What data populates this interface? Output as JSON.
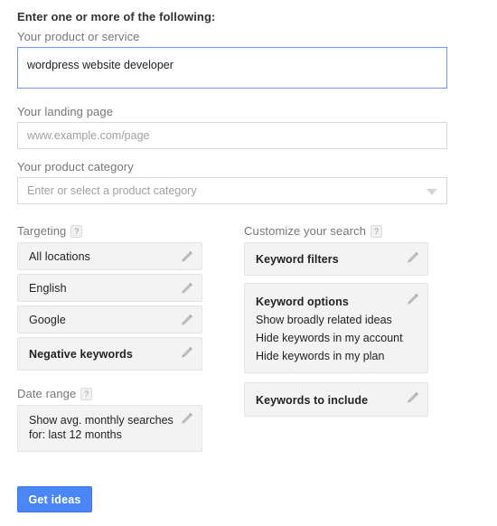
{
  "form": {
    "title": "Enter one or more of the following:",
    "product_service": {
      "label": "Your product or service",
      "value": "wordpress website developer"
    },
    "landing_page": {
      "label": "Your landing page",
      "placeholder": "www.example.com/page",
      "value": ""
    },
    "product_category": {
      "label": "Your product category",
      "placeholder": "Enter or select a product category",
      "selected": ""
    }
  },
  "targeting": {
    "heading": "Targeting",
    "help": "?",
    "items": [
      {
        "title": "All locations",
        "bold": false
      },
      {
        "title": "English",
        "bold": false
      },
      {
        "title": "Google",
        "bold": false
      },
      {
        "title": "Negative keywords",
        "bold": true
      }
    ]
  },
  "date_range": {
    "heading": "Date range",
    "help": "?",
    "line1": "Show avg. monthly searches",
    "line2": "for: last 12 months"
  },
  "customize": {
    "heading": "Customize your search",
    "help": "?",
    "keyword_filters": {
      "title": "Keyword filters"
    },
    "keyword_options": {
      "title": "Keyword options",
      "lines": [
        "Show broadly related ideas",
        "Hide keywords in my account",
        "Hide keywords in my plan"
      ]
    },
    "keywords_to_include": {
      "title": "Keywords to include"
    }
  },
  "actions": {
    "get_ideas_label": "Get ideas"
  },
  "colors": {
    "accent_blue": "#4a86f7",
    "focus_border": "#6b9aed",
    "card_bg": "#f3f3f3",
    "label_gray": "#777777"
  }
}
